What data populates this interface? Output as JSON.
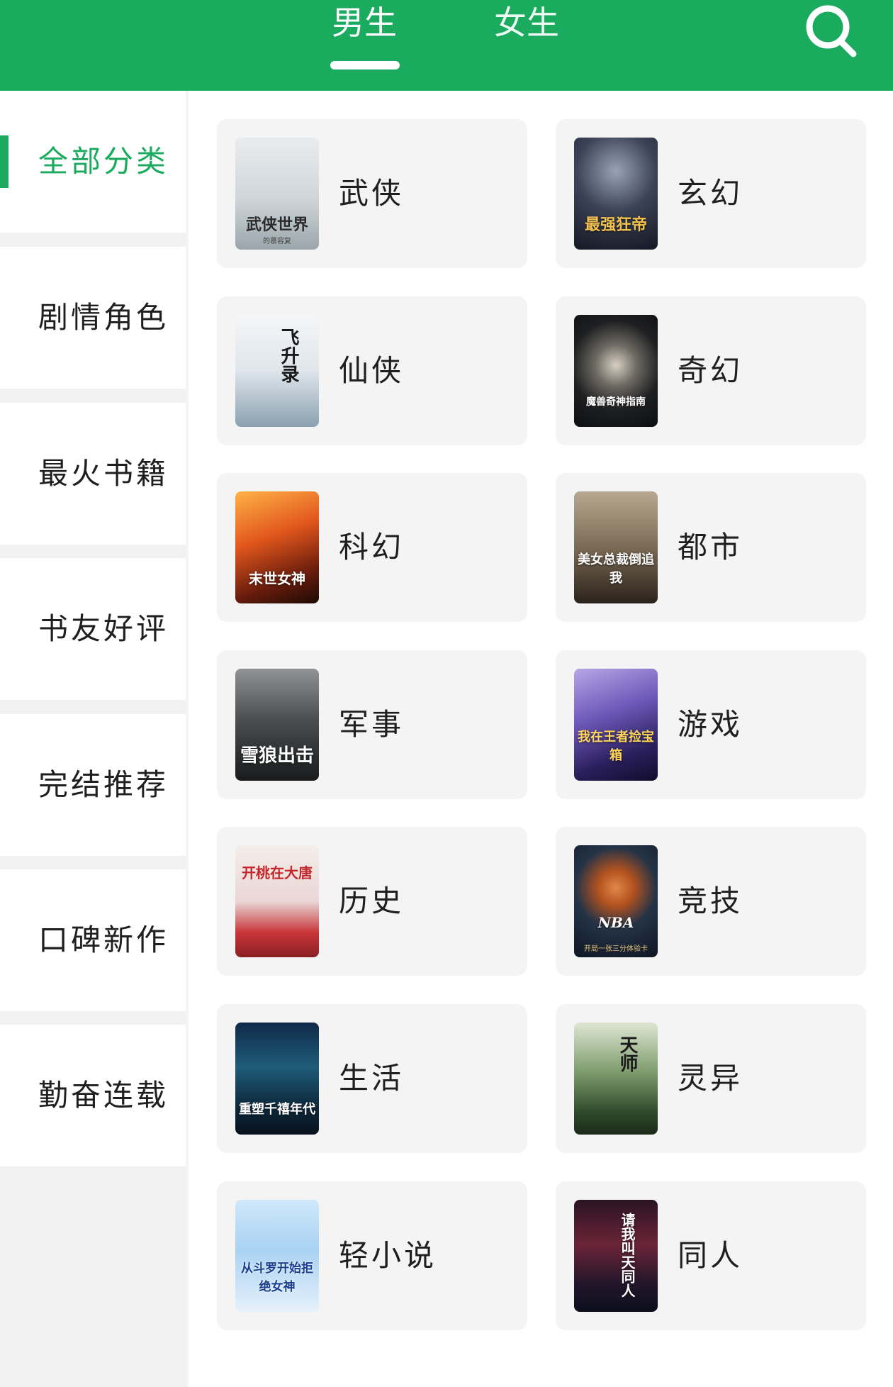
{
  "tabs": {
    "male": "男生",
    "female": "女生"
  },
  "sidebar": {
    "items": [
      {
        "label": "全部分类"
      },
      {
        "label": "剧情角色"
      },
      {
        "label": "最火书籍"
      },
      {
        "label": "书友好评"
      },
      {
        "label": "完结推荐"
      },
      {
        "label": "口碑新作"
      },
      {
        "label": "勤奋连载"
      }
    ]
  },
  "categories": [
    {
      "name": "武侠",
      "cover_title": "武侠世界",
      "cover_sub": "的慕容复"
    },
    {
      "name": "玄幻",
      "cover_title": "最强狂帝",
      "cover_sub": ""
    },
    {
      "name": "仙侠",
      "cover_title": "飞升录",
      "cover_sub": ""
    },
    {
      "name": "奇幻",
      "cover_title": "魔兽奇神指南",
      "cover_sub": ""
    },
    {
      "name": "科幻",
      "cover_title": "末世女神",
      "cover_sub": ""
    },
    {
      "name": "都市",
      "cover_title": "美女总裁倒追我",
      "cover_sub": ""
    },
    {
      "name": "军事",
      "cover_title": "雪狼出击",
      "cover_sub": ""
    },
    {
      "name": "游戏",
      "cover_title": "我在王者捡宝箱",
      "cover_sub": ""
    },
    {
      "name": "历史",
      "cover_title": "开桃在大唐",
      "cover_sub": ""
    },
    {
      "name": "竞技",
      "cover_title": "NBA",
      "cover_sub": "开局一张三分体验卡"
    },
    {
      "name": "生活",
      "cover_title": "重塑千禧年代",
      "cover_sub": ""
    },
    {
      "name": "灵异",
      "cover_title": "天师",
      "cover_sub": ""
    },
    {
      "name": "轻小说",
      "cover_title": "从斗罗开始拒绝女神",
      "cover_sub": ""
    },
    {
      "name": "同人",
      "cover_title": "请我叫天同人",
      "cover_sub": ""
    }
  ],
  "colors": {
    "accent": "#1aab5f",
    "text": "#1f1f1f",
    "card_bg": "#f4f4f4",
    "sidebar_bg": "#f2f2f2"
  },
  "icons": {
    "search": "search-icon"
  }
}
